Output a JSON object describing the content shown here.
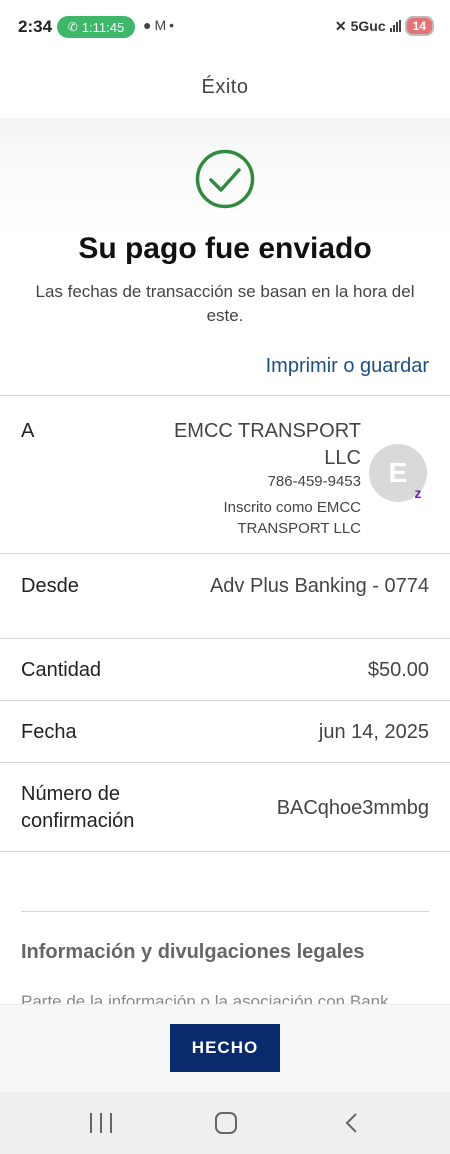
{
  "status_bar": {
    "time": "2:34",
    "call_timer": "1:11:45",
    "network": "5Guc",
    "battery": "14"
  },
  "header": {
    "title": "Éxito"
  },
  "confirmation": {
    "title": "Su pago fue enviado",
    "subtitle": "Las fechas de transacción se basan en la hora del este.",
    "print_link": "Imprimir o guardar"
  },
  "details": {
    "to_label": "A",
    "payee_name": "EMCC TRANSPORT LLC",
    "payee_phone": "786-459-9453",
    "payee_enrolled": "Inscrito como EMCC TRANSPORT LLC",
    "avatar_initial": "E",
    "zelle_badge": "z",
    "from_label": "Desde",
    "from_value": "Adv Plus Banking - 0774",
    "amount_label": "Cantidad",
    "amount_value": "$50.00",
    "date_label": "Fecha",
    "date_value": "jun 14, 2025",
    "confirmation_label": "Número de confirmación",
    "confirmation_value": "BACqhoe3mmbg"
  },
  "legal": {
    "title": "Información y divulgaciones legales",
    "cut_text": "Parte de la información o la asociación con Bank"
  },
  "footer": {
    "done_label": "HECHO"
  },
  "colors": {
    "accent_link": "#1b4f8a",
    "done_button": "#0a2a6e",
    "success_green": "#2e8b3e",
    "call_pill": "#3db86a",
    "zelle_purple": "#6d1ed4"
  }
}
